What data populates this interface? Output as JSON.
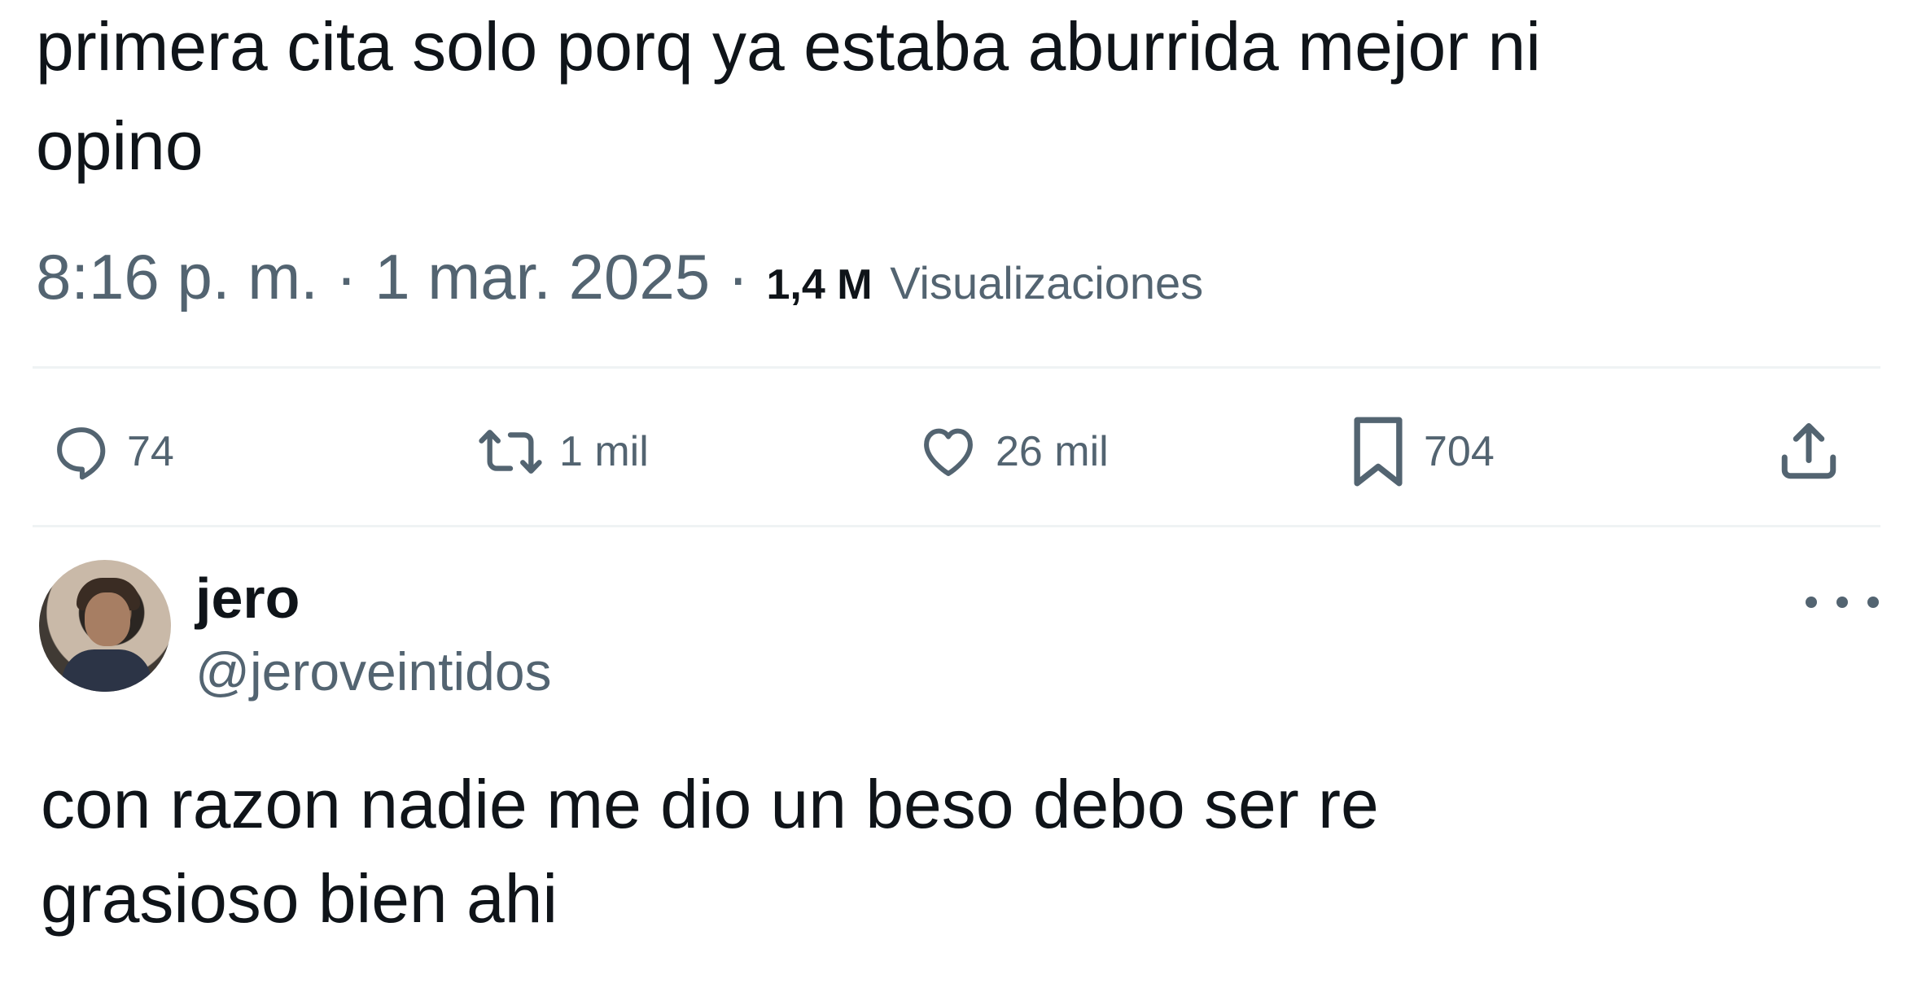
{
  "tweet": {
    "text_line1": "primera cita solo porq ya estaba aburrida mejor ni",
    "text_line2": "opino",
    "time": "8:16 p. m.",
    "sep1": " · ",
    "date": "1 mar. 2025",
    "sep2": " · ",
    "views_count": "1,4 M",
    "views_label": "Visualizaciones"
  },
  "actions": {
    "reply_count": "74",
    "retweet_count": "1 mil",
    "like_count": "26 mil",
    "bookmark_count": "704"
  },
  "reply": {
    "display_name": "jero",
    "handle": "@jeroveintidos",
    "text_line1": "con razon nadie me dio un beso debo ser re",
    "text_line2": "grasioso bien ahi"
  },
  "icons": {
    "reply": "reply-icon",
    "retweet": "retweet-icon",
    "like": "heart-icon",
    "bookmark": "bookmark-icon",
    "share": "share-icon",
    "more": "more-icon"
  },
  "colors": {
    "text": "#0f1419",
    "secondary": "#536471",
    "divider": "#eff3f4"
  }
}
